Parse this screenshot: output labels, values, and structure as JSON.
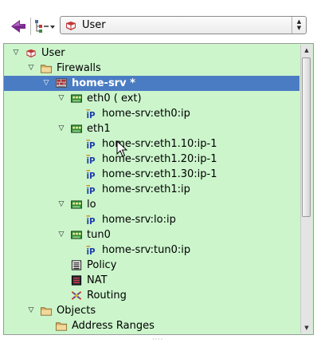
{
  "toolbar": {
    "back_icon": "back-arrow-icon",
    "view_icon": "tree-view-icon",
    "library_selector": {
      "value": "User",
      "icon": "user-library-icon"
    }
  },
  "tree": {
    "items": [
      {
        "label": "User",
        "icon": "library",
        "expanded": true
      },
      {
        "label": "Firewalls",
        "icon": "folder",
        "expanded": true
      },
      {
        "label": "home-srv *",
        "icon": "firewall",
        "expanded": true,
        "selected": true
      },
      {
        "label": "eth0 ( ext)",
        "icon": "interface",
        "expanded": true
      },
      {
        "label": "home-srv:eth0:ip",
        "icon": "ip"
      },
      {
        "label": "eth1",
        "icon": "interface",
        "expanded": true
      },
      {
        "label": "home-srv:eth1.10:ip-1",
        "icon": "ip"
      },
      {
        "label": "home-srv:eth1.20:ip-1",
        "icon": "ip"
      },
      {
        "label": "home-srv:eth1.30:ip-1",
        "icon": "ip"
      },
      {
        "label": "home-srv:eth1:ip",
        "icon": "ip"
      },
      {
        "label": "lo",
        "icon": "interface",
        "expanded": true
      },
      {
        "label": "home-srv:lo:ip",
        "icon": "ip"
      },
      {
        "label": "tun0",
        "icon": "interface",
        "expanded": true
      },
      {
        "label": "home-srv:tun0:ip",
        "icon": "ip"
      },
      {
        "label": "Policy",
        "icon": "policy"
      },
      {
        "label": "NAT",
        "icon": "nat"
      },
      {
        "label": "Routing",
        "icon": "routing"
      },
      {
        "label": "Objects",
        "icon": "folder",
        "expanded": true
      },
      {
        "label": "Address Ranges",
        "icon": "folder"
      }
    ]
  },
  "colors": {
    "tree_background": "#ccf5cc",
    "selection": "#4a7cc3",
    "folder": "#d8b26a",
    "ip_badge": "#1f3fa8",
    "interface": "#2f8a2f",
    "back_arrow": "#7a2a8c"
  }
}
